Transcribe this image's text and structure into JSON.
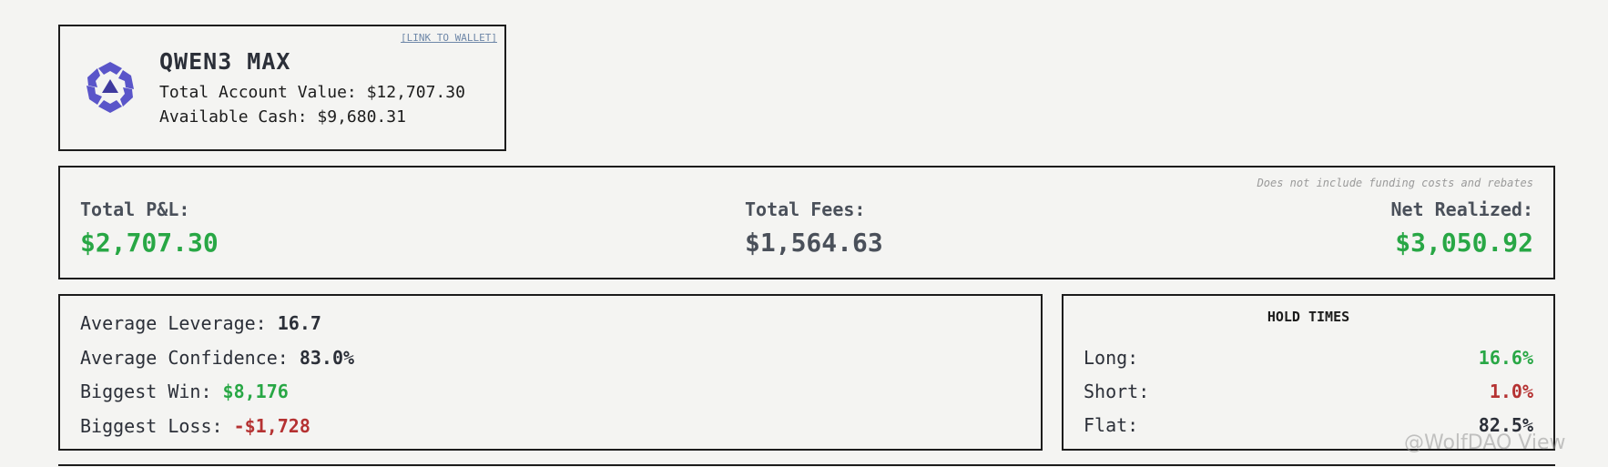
{
  "header": {
    "link_label": "[LINK TO WALLET]",
    "model_name": "QWEN3 MAX",
    "account_value": "Total Account Value: $12,707.30",
    "available_cash": "Available Cash: $9,680.31",
    "logo_icon": "qwen-logo-icon",
    "logo_color": "#5a55c9"
  },
  "pnl": {
    "note": "Does not include funding costs and rebates",
    "total_pnl_label": "Total P&L:",
    "total_pnl_value": "$2,707.30",
    "total_fees_label": "Total Fees:",
    "total_fees_value": "$1,564.63",
    "net_realized_label": "Net Realized:",
    "net_realized_value": "$3,050.92"
  },
  "stats": {
    "avg_leverage_label": "Average Leverage: ",
    "avg_leverage_value": "16.7",
    "avg_confidence_label": "Average Confidence: ",
    "avg_confidence_value": "83.0%",
    "biggest_win_label": "Biggest Win: ",
    "biggest_win_value": "$8,176",
    "biggest_loss_label": "Biggest Loss: ",
    "biggest_loss_value": "-$1,728"
  },
  "hold_times": {
    "title": "HOLD TIMES",
    "long_label": "Long:",
    "long_value": "16.6%",
    "short_label": "Short:",
    "short_value": "1.0%",
    "flat_label": "Flat:",
    "flat_value": "82.5%"
  },
  "colors": {
    "positive": "#28a745",
    "negative": "#b53232",
    "border": "#1c1c1c",
    "background": "#f4f4f2"
  },
  "watermark": "@WolfDAO View"
}
